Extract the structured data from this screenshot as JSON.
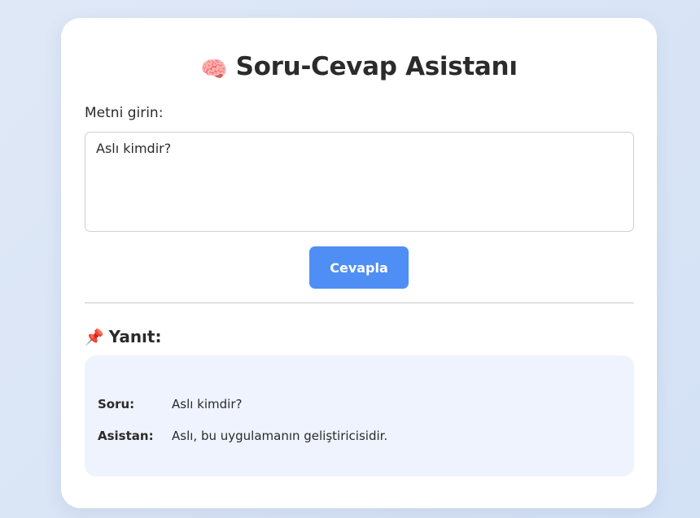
{
  "app": {
    "title_emoji": "🧠",
    "title": "Soru-Cevap Asistanı"
  },
  "input": {
    "label": "Metni girin:",
    "value": "Aslı kimdir?"
  },
  "submit": {
    "label": "Cevapla"
  },
  "answer": {
    "heading_emoji": "📌",
    "heading": "Yanıt:",
    "rows": [
      {
        "key": "Soru:",
        "value": "Aslı kimdir?"
      },
      {
        "key": "Asistan:",
        "value": "Aslı, bu uygulamanın geliştiricisidir."
      }
    ]
  },
  "colors": {
    "accent": "#4f8ff5",
    "answer_bg": "#eef3fd",
    "page_bg": "#dbe6f6"
  }
}
